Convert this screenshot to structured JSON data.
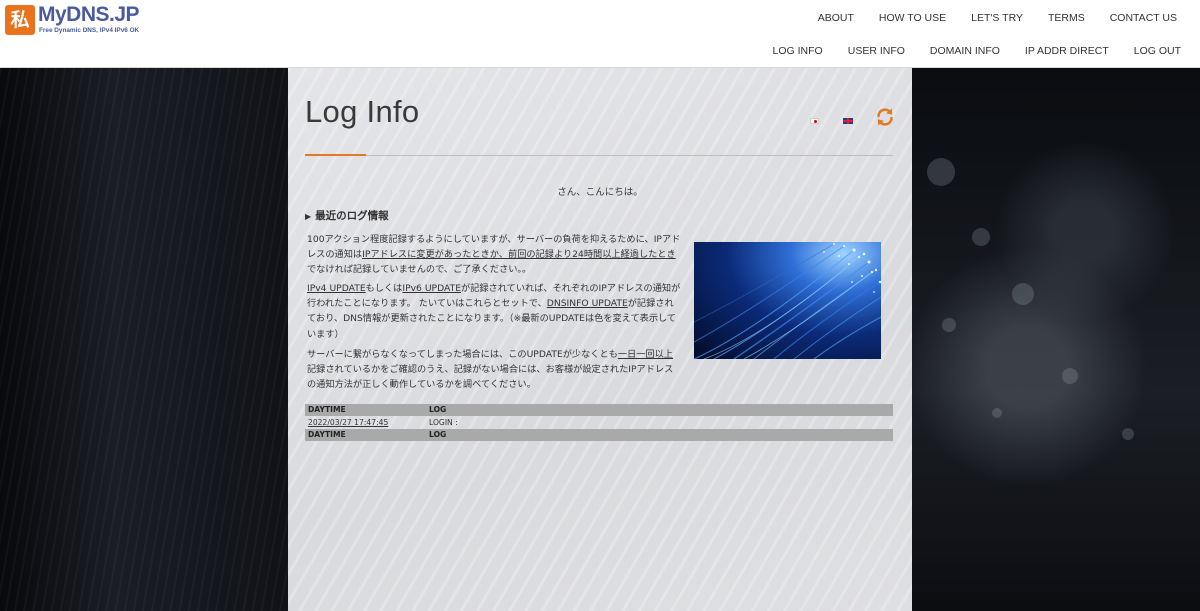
{
  "logo": {
    "mark": "私",
    "title": "MyDNS.JP",
    "subtitle": "Free Dynamic DNS, IPv4 IPv6 OK"
  },
  "nav": {
    "top": [
      "ABOUT",
      "HOW TO USE",
      "LET'S TRY",
      "TERMS",
      "CONTACT US"
    ],
    "bottom": [
      "LOG INFO",
      "USER INFO",
      "DOMAIN INFO",
      "IP ADDR DIRECT",
      "LOG OUT"
    ]
  },
  "page": {
    "title": "Log Info",
    "greeting": "さん、こんにちは。",
    "section_heading": "最近のログ情報",
    "p1": {
      "t1": "100アクション程度記録するようにしていますが、サーバーの負荷を抑えるために、IPアドレスの通知は",
      "l1": "IPアドレスに変更があったときか、前回の記録より24時間以上経過したとき",
      "t2": "でなければ記録していませんので、ご了承ください。。"
    },
    "p2": {
      "l1": "IPv4 UPDATE",
      "t1": "もしくは",
      "l2": "IPv6 UPDATE",
      "t2": "が記録されていれば、それぞれのIPアドレスの通知が行われたことになります。 たいていはこれらとセットで、",
      "l3": "DNSINFO UPDATE",
      "t3": "が記録されており、DNS情報が更新されたことになります。（※最新のUPDATEは色を変えて表示しています）"
    },
    "p3": {
      "t1": "サーバーに繋がらなくなってしまった場合には、このUPDATEが少なくとも",
      "l1": "一日一回以上",
      "t2": "記録されているかをご確認のうえ、記録がない場合には、お客様が設定されたIPアドレスの通知方法が正しく動作しているかを調べてください。"
    }
  },
  "log_table": {
    "headers": [
      "DAYTIME",
      "LOG"
    ],
    "rows": [
      {
        "daytime": "2022/03/27 17:47:45",
        "log": "LOGIN :"
      }
    ],
    "footer": [
      "DAYTIME",
      "LOG"
    ]
  },
  "colors": {
    "accent": "#e07a24",
    "logo_blue": "#4a5a9e",
    "table_header": "#a9a9a9"
  },
  "icons": [
    "refresh-icon",
    "japan-flag-icon",
    "uk-flag-icon"
  ]
}
